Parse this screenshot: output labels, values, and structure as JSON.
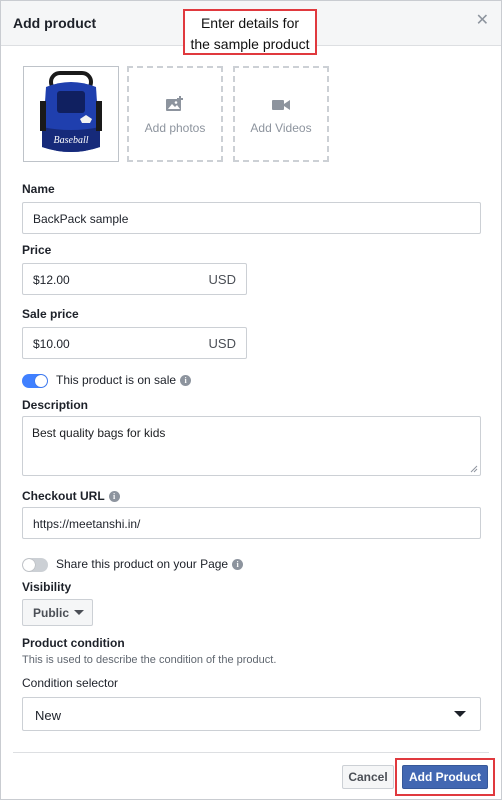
{
  "dialog": {
    "title": "Add product"
  },
  "annotation": {
    "line1": "Enter details for",
    "line2": "the sample product",
    "color": "#e0393e"
  },
  "media": {
    "add_photos": "Add photos",
    "add_videos": "Add Videos",
    "image_text": "Baseball"
  },
  "name": {
    "label": "Name",
    "value": "BackPack sample"
  },
  "price": {
    "label": "Price",
    "value": "$12.00",
    "currency": "USD"
  },
  "sale_price": {
    "label": "Sale price",
    "value": "$10.00",
    "currency": "USD"
  },
  "on_sale": {
    "label": "This product is on sale",
    "enabled": true
  },
  "description": {
    "label": "Description",
    "value": "Best quality bags for kids"
  },
  "checkout": {
    "label": "Checkout URL",
    "value": "https://meetanshi.in/"
  },
  "share": {
    "label": "Share this product on your Page",
    "enabled": false
  },
  "visibility": {
    "label": "Visibility",
    "value": "Public"
  },
  "condition": {
    "label": "Product condition",
    "helper": "This is used to describe the condition of the product.",
    "selector_label": "Condition selector",
    "value": "New"
  },
  "footer": {
    "cancel": "Cancel",
    "add": "Add Product"
  },
  "colors": {
    "accent": "#4267b2",
    "toggle_on": "#4080ff",
    "highlight": "#e0393e"
  }
}
